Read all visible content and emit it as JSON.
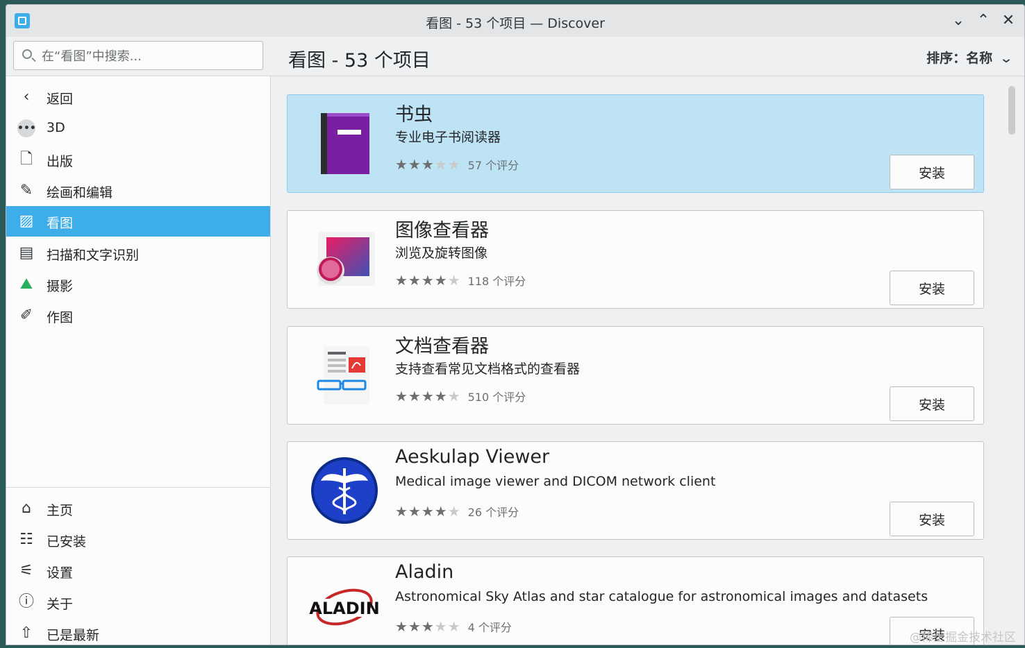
{
  "titlebar": {
    "title": "看图 - 53 个项目 — Discover"
  },
  "search": {
    "placeholder": "在“看图”中搜索..."
  },
  "header": {
    "page_title": "看图 - 53 个项目",
    "sort_label": "排序：名称"
  },
  "sidebar": {
    "items": [
      {
        "label": "返回",
        "icon": "back-icon"
      },
      {
        "label": "3D",
        "icon": "more-dots-icon"
      },
      {
        "label": "出版",
        "icon": "document-icon"
      },
      {
        "label": "绘画和编辑",
        "icon": "brush-icon"
      },
      {
        "label": "看图",
        "icon": "image-viewer-icon",
        "active": true
      },
      {
        "label": "扫描和文字识别",
        "icon": "scanner-icon"
      },
      {
        "label": "摄影",
        "icon": "photo-icon"
      },
      {
        "label": "作图",
        "icon": "draw-icon"
      }
    ],
    "bottom_items": [
      {
        "label": "主页",
        "icon": "home-icon"
      },
      {
        "label": "已安装",
        "icon": "installed-icon"
      },
      {
        "label": "设置",
        "icon": "settings-icon"
      },
      {
        "label": "关于",
        "icon": "info-icon"
      },
      {
        "label": "已是最新",
        "icon": "update-icon"
      }
    ]
  },
  "apps": [
    {
      "name": "书虫",
      "summary": "专业电子书阅读器",
      "stars": 3,
      "rating_text": "57 个评分",
      "install_label": "安装",
      "icon": "book-icon",
      "selected": true
    },
    {
      "name": "图像查看器",
      "summary": "浏览及旋转图像",
      "stars": 4,
      "rating_text": "118 个评分",
      "install_label": "安装",
      "icon": "image-icon"
    },
    {
      "name": "文档查看器",
      "summary": "支持查看常见文档格式的查看器",
      "stars": 4,
      "rating_text": "510 个评分",
      "install_label": "安装",
      "icon": "document-viewer-icon"
    },
    {
      "name": "Aeskulap Viewer",
      "summary": "Medical image viewer and DICOM network client",
      "stars": 4,
      "rating_text": "26 个评分",
      "install_label": "安装",
      "icon": "caduceus-icon"
    },
    {
      "name": "Aladin",
      "summary": "Astronomical Sky Atlas and star catalogue for astronomical images and datasets",
      "stars": 3,
      "rating_text": "4 个评分",
      "install_label": "安装",
      "icon": "aladin-logo-icon"
    }
  ],
  "colors": {
    "accent": "#3daee9",
    "selected_card": "#bee3f5"
  },
  "watermark": "@稀土掘金技术社区"
}
